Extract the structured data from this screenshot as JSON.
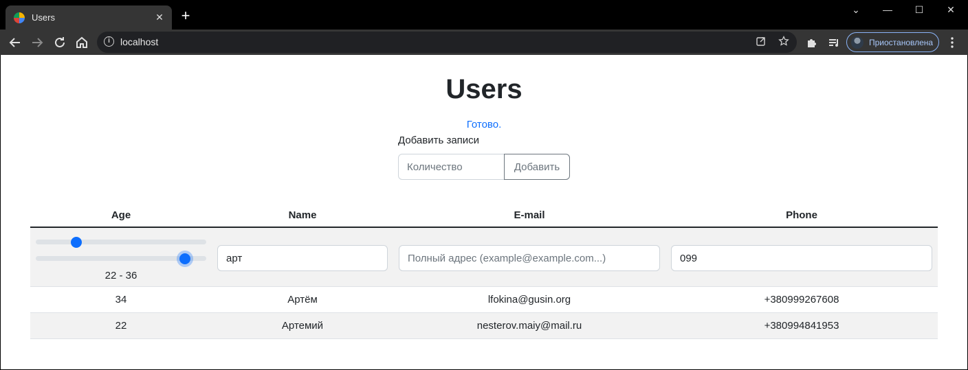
{
  "browser": {
    "tab_title": "Users",
    "tab_close": "✕",
    "new_tab": "+",
    "url": "localhost",
    "profile_label": "Приостановлена",
    "window_controls": {
      "dropdown": "⌄",
      "minimize": "—",
      "maximize": "☐",
      "close": "✕"
    }
  },
  "page": {
    "title": "Users",
    "status": "Готово.",
    "add_section": {
      "label": "Добавить записи",
      "quantity_placeholder": "Количество",
      "add_button": "Добавить"
    }
  },
  "table": {
    "columns": [
      "Age",
      "Name",
      "E-mail",
      "Phone"
    ],
    "filters": {
      "age_min": 22,
      "age_max": 36,
      "age_range_text": "22 - 36",
      "name_value": "арт",
      "email_value": "",
      "email_placeholder": "Полный адрес (example@example.com...)",
      "phone_value": "099"
    },
    "rows": [
      {
        "age": "34",
        "name": "Артём",
        "email": "lfokina@gusin.org",
        "phone": "+380999267608"
      },
      {
        "age": "22",
        "name": "Артемий",
        "email": "nesterov.maiy@mail.ru",
        "phone": "+380994841953"
      }
    ]
  },
  "colors": {
    "accent": "#0d6efd",
    "chrome_bg": "#353535",
    "stripe": "#f2f2f2"
  },
  "icons": [
    "back-arrow-icon",
    "forward-arrow-icon",
    "reload-icon",
    "home-icon",
    "info-icon",
    "share-icon",
    "star-icon",
    "extensions-icon",
    "reading-list-icon",
    "menu-dots-icon"
  ]
}
